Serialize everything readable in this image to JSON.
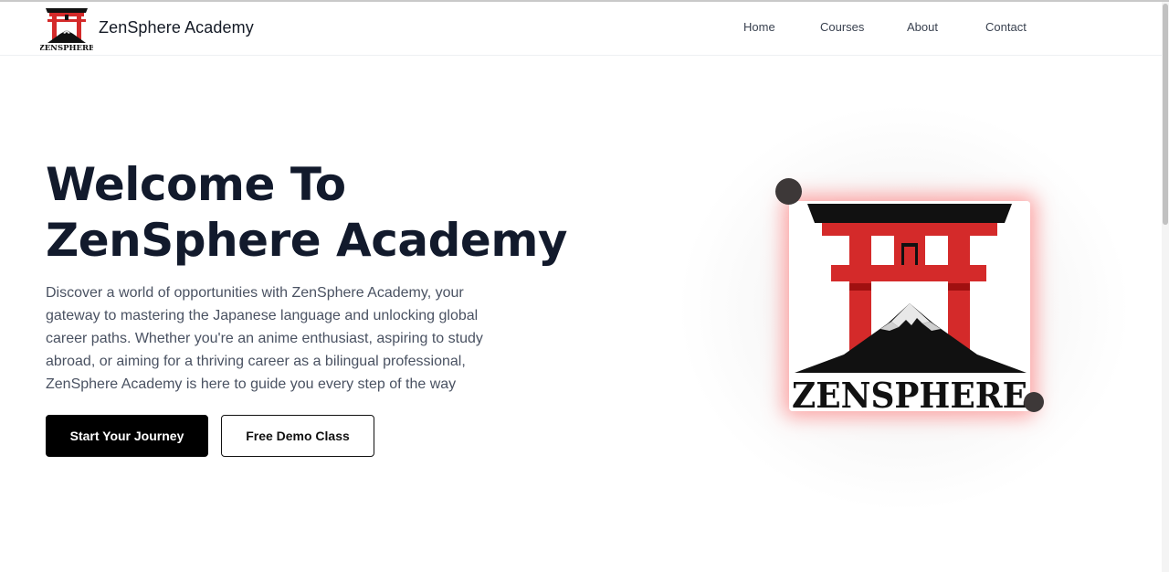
{
  "brand": {
    "name": "ZenSphere Academy",
    "logo_text": "ZENSPHERE"
  },
  "nav": {
    "items": [
      {
        "label": "Home"
      },
      {
        "label": "Courses"
      },
      {
        "label": "About"
      },
      {
        "label": "Contact"
      }
    ]
  },
  "hero": {
    "title_line1": "Welcome To",
    "title_line2": "ZenSphere Academy",
    "description": "Discover a world of opportunities with ZenSphere Academy, your gateway to mastering the Japanese language and unlocking global career paths. Whether you're an anime enthusiast, aspiring to study abroad, or aiming for a thriving career as a bilingual professional, ZenSphere Academy is here to guide you every step of the way",
    "primary_button": "Start Your Journey",
    "secondary_button": "Free Demo Class"
  },
  "colors": {
    "accent_red": "#d42a2a",
    "glow": "#ff5a5a",
    "text_dark": "#121a2c",
    "button_dark": "#000000"
  }
}
